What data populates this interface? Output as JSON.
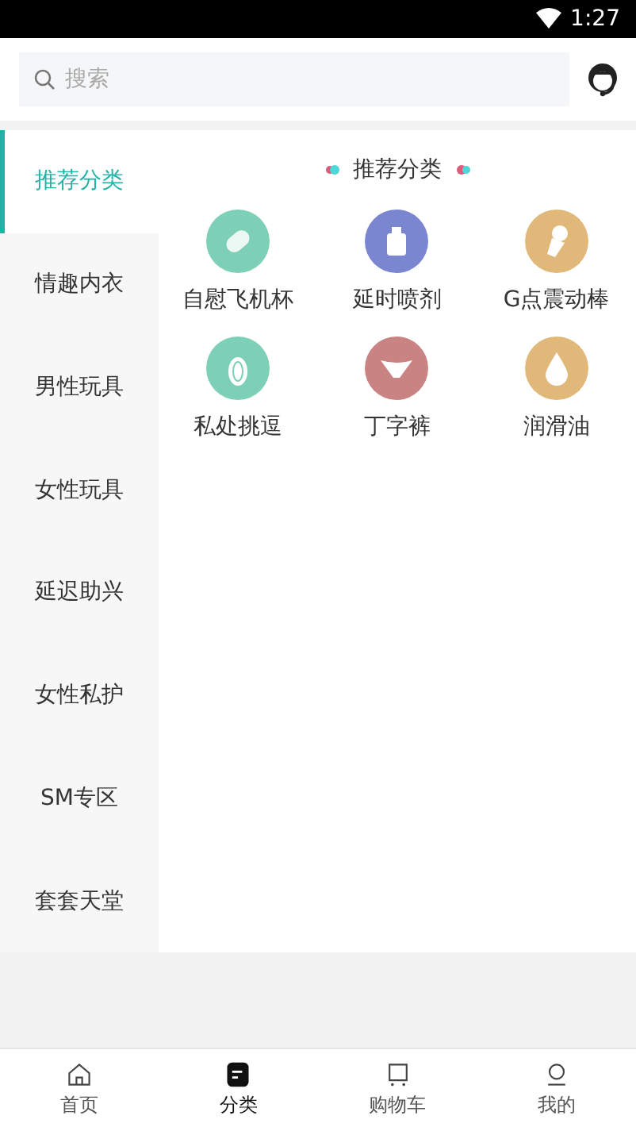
{
  "status_bar": {
    "time": "1:27"
  },
  "search": {
    "placeholder": "搜索"
  },
  "sidebar": {
    "items": [
      {
        "label": "推荐分类",
        "selected": true
      },
      {
        "label": "情趣内衣",
        "selected": false
      },
      {
        "label": "男性玩具",
        "selected": false
      },
      {
        "label": "女性玩具",
        "selected": false
      },
      {
        "label": "延迟助兴",
        "selected": false
      },
      {
        "label": "女性私护",
        "selected": false
      },
      {
        "label": "SM专区",
        "selected": false
      },
      {
        "label": "套套天堂",
        "selected": false
      }
    ]
  },
  "section": {
    "title": "推荐分类"
  },
  "categories": [
    {
      "label": "自慰飞机杯",
      "kind": "cup",
      "color": "#7dcfb6"
    },
    {
      "label": "延时喷剂",
      "kind": "bottle",
      "color": "#7b86d1"
    },
    {
      "label": "G点震动棒",
      "kind": "wand",
      "color": "#e0b97a"
    },
    {
      "label": "私处挑逗",
      "kind": "egg",
      "color": "#7dcfb6"
    },
    {
      "label": "丁字裤",
      "kind": "briefs",
      "color": "#c98383"
    },
    {
      "label": "润滑油",
      "kind": "drop",
      "color": "#e0b97a"
    }
  ],
  "tab_bar": [
    {
      "label": "首页",
      "kind": "home",
      "selected": false
    },
    {
      "label": "分类",
      "kind": "category",
      "selected": true
    },
    {
      "label": "购物车",
      "kind": "cart",
      "selected": false
    },
    {
      "label": "我的",
      "kind": "user",
      "selected": false
    }
  ]
}
